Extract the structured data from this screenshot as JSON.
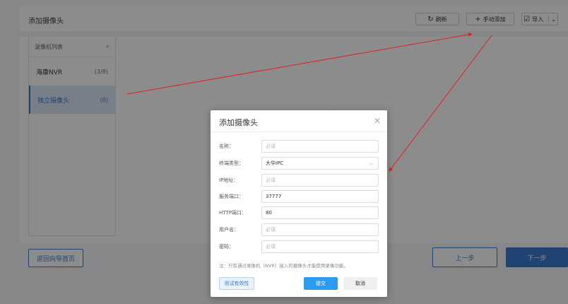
{
  "header": {
    "title": "添加摄像头",
    "refresh_label": "刷新",
    "manual_add_label": "手动添加",
    "import_label": "导入"
  },
  "sidebar": {
    "title": "录像机列表",
    "items": [
      {
        "label": "海康NVR",
        "count": "(3/8)"
      },
      {
        "label": "独立摄像头",
        "count": "(0)"
      }
    ]
  },
  "footer": {
    "back_label": "返回向导首页",
    "prev_label": "上一步",
    "next_label": "下一步"
  },
  "modal": {
    "title": "添加摄像头",
    "fields": [
      {
        "label": "名称：",
        "value": "必填",
        "is_placeholder": true
      },
      {
        "label": "终端类型：",
        "value": "大华IPC",
        "is_placeholder": false
      },
      {
        "label": "IP地址：",
        "value": "必填",
        "is_placeholder": true
      },
      {
        "label": "服务端口：",
        "value": "37777",
        "is_placeholder": false
      },
      {
        "label": "HTTP端口：",
        "value": "80",
        "is_placeholder": false
      },
      {
        "label": "用户名：",
        "value": "必填",
        "is_placeholder": true
      },
      {
        "label": "密码：",
        "value": "必填",
        "is_placeholder": true
      }
    ],
    "note": "注：只有通过录像机（NVR）接入的摄像头才能使用录像功能。",
    "test_label": "测试有效性",
    "submit_label": "提交",
    "cancel_label": "取消"
  },
  "colors": {
    "primary": "#3b7bd1",
    "submit": "#2a9bf0",
    "annotation_arrow": "#e02020"
  }
}
